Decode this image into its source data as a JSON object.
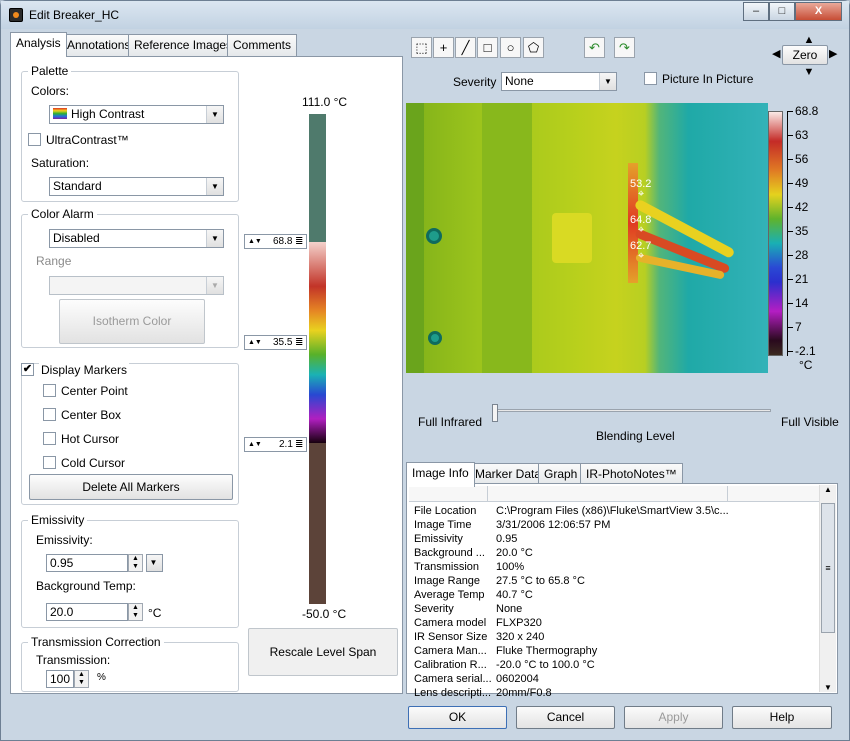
{
  "window": {
    "title": "Edit Breaker_HC",
    "minimize": "–",
    "maximize": "□",
    "close": "X"
  },
  "left_tabs": [
    "Analysis",
    "Annotations",
    "Reference Images",
    "Comments"
  ],
  "palette": {
    "group": "Palette",
    "colors_label": "Colors:",
    "colors_value": "High Contrast",
    "ultracontrast_label": "UltraContrast™",
    "saturation_label": "Saturation:",
    "saturation_value": "Standard"
  },
  "color_alarm": {
    "group": "Color Alarm",
    "value": "Disabled",
    "range_label": "Range",
    "isotherm_button": "Isotherm Color"
  },
  "markers": {
    "group_label": "Display Markers",
    "center_point": "Center Point",
    "center_box": "Center Box",
    "hot_cursor": "Hot Cursor",
    "cold_cursor": "Cold Cursor",
    "delete_all": "Delete All Markers",
    "checked": "✔"
  },
  "emissivity": {
    "group": "Emissivity",
    "emissivity_label": "Emissivity:",
    "emissivity_value": "0.95",
    "background_label": "Background Temp:",
    "background_value": "20.0",
    "background_unit": "°C"
  },
  "transmission": {
    "group": "Transmission Correction",
    "label": "Transmission:",
    "value": "100",
    "unit": "%"
  },
  "scale": {
    "top_label": "111.0 °C",
    "bottom_label": "-50.0 °C",
    "level_high": "68.8",
    "level_mid": "35.5",
    "level_low": "2.1",
    "rescale_label": "Rescale Level  Span"
  },
  "toolbar": {
    "zero_label": "Zero"
  },
  "severity": {
    "label": "Severity",
    "value": "None",
    "pip_label": "Picture In Picture"
  },
  "thermal_scale": [
    "68.8",
    "63",
    "56",
    "49",
    "42",
    "35",
    "28",
    "21",
    "14",
    "7",
    "-2.1"
  ],
  "thermal_unit": "°C",
  "thermal_markers": [
    {
      "label": "53.2"
    },
    {
      "label": "64.8"
    },
    {
      "label": "62.7"
    }
  ],
  "blending": {
    "left": "Full Infrared",
    "right": "Full Visible",
    "label": "Blending Level"
  },
  "info_tabs": [
    "Image Info",
    "Marker Data",
    "Graph",
    "IR-PhotoNotes™"
  ],
  "info_rows": [
    {
      "k": "File Location",
      "v": "C:\\Program Files (x86)\\Fluke\\SmartView 3.5\\c..."
    },
    {
      "k": "Image Time",
      "v": "3/31/2006 12:06:57 PM"
    },
    {
      "k": "Emissivity",
      "v": "0.95"
    },
    {
      "k": "Background ...",
      "v": "20.0 °C"
    },
    {
      "k": "Transmission",
      "v": "100%"
    },
    {
      "k": "Image Range",
      "v": "27.5 °C to 65.8 °C"
    },
    {
      "k": "Average Temp",
      "v": "40.7 °C"
    },
    {
      "k": "Severity",
      "v": "None"
    },
    {
      "k": "Camera model",
      "v": "FLXP320"
    },
    {
      "k": "IR Sensor Size",
      "v": "320 x 240"
    },
    {
      "k": "Camera Man...",
      "v": "Fluke Thermography"
    },
    {
      "k": "Calibration R...",
      "v": "-20.0 °C to 100.0 °C"
    },
    {
      "k": "Camera serial...",
      "v": "0602004"
    },
    {
      "k": "Lens descripti...",
      "v": "20mm/F0.8"
    }
  ],
  "footer": {
    "ok": "OK",
    "cancel": "Cancel",
    "apply": "Apply",
    "help": "Help"
  }
}
